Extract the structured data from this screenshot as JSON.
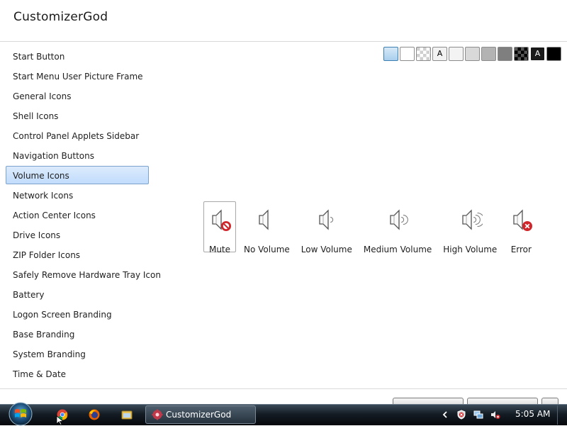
{
  "app": {
    "title": "CustomizerGod"
  },
  "sidebar": {
    "items": [
      {
        "label": "Start Button",
        "selected": false
      },
      {
        "label": "Start Menu User Picture Frame",
        "selected": false
      },
      {
        "label": "General Icons",
        "selected": false
      },
      {
        "label": "Shell Icons",
        "selected": false
      },
      {
        "label": "Control Panel Applets Sidebar",
        "selected": false
      },
      {
        "label": "Navigation Buttons",
        "selected": false
      },
      {
        "label": "Volume Icons",
        "selected": true
      },
      {
        "label": "Network Icons",
        "selected": false
      },
      {
        "label": "Action Center Icons",
        "selected": false
      },
      {
        "label": "Drive Icons",
        "selected": false
      },
      {
        "label": "ZIP Folder Icons",
        "selected": false
      },
      {
        "label": "Safely Remove Hardware Tray Icon",
        "selected": false
      },
      {
        "label": "Battery",
        "selected": false
      },
      {
        "label": "Logon Screen Branding",
        "selected": false
      },
      {
        "label": "Base Branding",
        "selected": false
      },
      {
        "label": "System Branding",
        "selected": false
      },
      {
        "label": "Time & Date",
        "selected": false
      }
    ]
  },
  "background_swatches": [
    {
      "name": "light-blue",
      "color": "#bcd8f0",
      "selected": true
    },
    {
      "name": "white",
      "color": "#ffffff"
    },
    {
      "name": "checker",
      "color": "#e0e0e0"
    },
    {
      "name": "text-light",
      "color": "#f2f2f2",
      "label": "A"
    },
    {
      "name": "very-light-gray",
      "color": "#f3f3f3"
    },
    {
      "name": "light-gray",
      "color": "#d9d9d9"
    },
    {
      "name": "gray",
      "color": "#b3b3b3"
    },
    {
      "name": "dark-gray",
      "color": "#7f7f7f"
    },
    {
      "name": "dark-checker",
      "color": "#2a2a2a"
    },
    {
      "name": "text-dark",
      "color": "#1a1a1a",
      "label": "A"
    },
    {
      "name": "black",
      "color": "#000000"
    }
  ],
  "volume_icons": [
    {
      "label": "Mute",
      "icon": "speaker-mute-icon",
      "selected": true
    },
    {
      "label": "No Volume",
      "icon": "speaker-no-volume-icon"
    },
    {
      "label": "Low Volume",
      "icon": "speaker-low-volume-icon"
    },
    {
      "label": "Medium Volume",
      "icon": "speaker-medium-volume-icon"
    },
    {
      "label": "High Volume",
      "icon": "speaker-high-volume-icon"
    },
    {
      "label": "Error",
      "icon": "speaker-error-icon"
    }
  ],
  "taskbar": {
    "start_icon": "windows-orb-icon",
    "pinned": [
      "chrome-icon",
      "firefox-icon",
      "explorer-folder-icon"
    ],
    "active_task": {
      "label": "CustomizerGod",
      "icon": "customizergod-gear-icon"
    },
    "tray_icons": [
      "chevron-left-icon",
      "security-icon",
      "network-icon",
      "volume-mute-tray-icon"
    ],
    "clock": "5:05 AM"
  }
}
